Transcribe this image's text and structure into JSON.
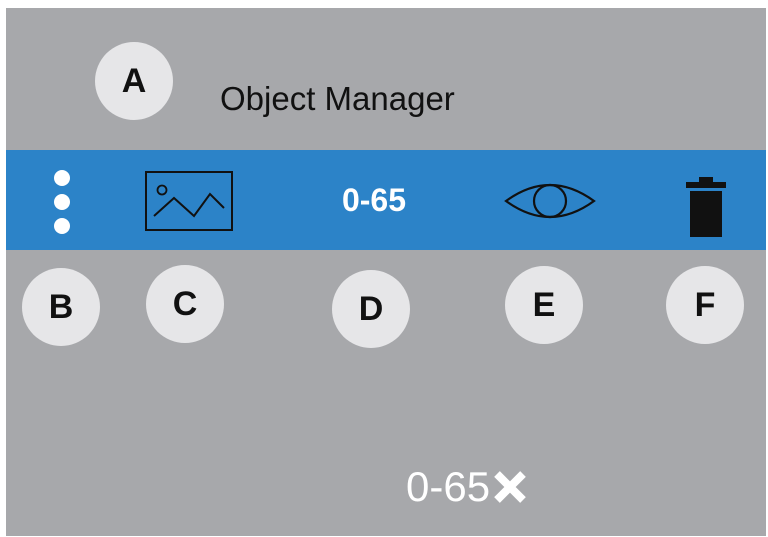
{
  "header": {
    "title": "Object Manager",
    "badge": "A"
  },
  "toolbar": {
    "menu_icon": "vertical-dots-icon",
    "image_icon": "image-thumbnail-icon",
    "range_label": "0-65",
    "visibility_icon": "eye-icon",
    "delete_icon": "trash-icon"
  },
  "callouts": [
    "B",
    "C",
    "D",
    "E",
    "F"
  ],
  "footer": {
    "range_value": "0-65",
    "clear_icon": "close-icon"
  },
  "colors": {
    "background": "#a7a8ab",
    "toolbar": "#2c83c8",
    "badge": "#e6e6e8",
    "icon_dark": "#111111",
    "text_light": "#ffffff"
  }
}
